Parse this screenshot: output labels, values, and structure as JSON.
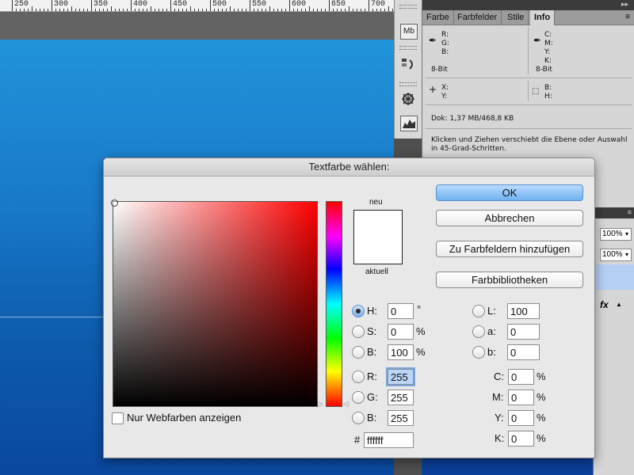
{
  "ruler": {
    "labels": [
      "250",
      "300",
      "350",
      "400",
      "450",
      "500",
      "550",
      "600",
      "650",
      "700"
    ]
  },
  "info_panel": {
    "tabs": [
      "Farbe",
      "Farbfelder",
      "Stile",
      "Info"
    ],
    "active_tab": "Info",
    "rgb_labels": "R:\nG:\nB:",
    "cmyk_labels": "C:\nM:\nY:\nK:",
    "bitdepth_left": "8-Bit",
    "bitdepth_right": "8-Bit",
    "xy_labels": "X:\nY:",
    "bh_labels": "B:\nH:",
    "doc_size": "Dok: 1,37 MB/468,8 KB",
    "hint": "Klicken und Ziehen verschiebt die Ebene oder Auswahl\nin 45-Grad-Schritten."
  },
  "icon_strip": [
    "Mb",
    "mini-bridge-icon",
    "history-icon",
    "navigator-icon",
    "histogram-icon"
  ],
  "layers_panel": {
    "opacity": "100%",
    "fill": "100%",
    "fx": "fx"
  },
  "dialog": {
    "title": "Textfarbe wählen:",
    "new_label": "neu",
    "current_label": "aktuell",
    "ok": "OK",
    "cancel": "Abbrechen",
    "add_swatch": "Zu Farbfeldern hinzufügen",
    "libraries": "Farbbibliotheken",
    "web_colors_only": "Nur Webfarben anzeigen",
    "hsb": {
      "H_label": "H:",
      "H": "0",
      "H_unit": "°",
      "S_label": "S:",
      "S": "0",
      "S_unit": "%",
      "B_label": "B:",
      "B": "100",
      "B_unit": "%"
    },
    "rgb": {
      "R_label": "R:",
      "R": "255",
      "G_label": "G:",
      "G": "255",
      "B_label": "B:",
      "B": "255"
    },
    "lab": {
      "L_label": "L:",
      "L": "100",
      "a_label": "a:",
      "a": "0",
      "b_label": "b:",
      "b": "0"
    },
    "cmyk": {
      "C_label": "C:",
      "C": "0",
      "M_label": "M:",
      "M": "0",
      "Y_label": "Y:",
      "Y": "0",
      "K_label": "K:",
      "K": "0",
      "unit": "%"
    },
    "hex_label": "#",
    "hex": "ffffff"
  },
  "colors": {
    "canvas_top": "#2194da",
    "canvas_bottom": "#0a48a0",
    "ok_button": "#6fb1f0",
    "selected_color": "#ffffff"
  }
}
